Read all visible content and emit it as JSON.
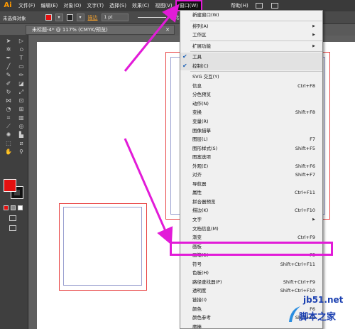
{
  "app": {
    "logo": "Ai"
  },
  "menubar": {
    "items": [
      {
        "label": "文件(F)"
      },
      {
        "label": "编辑(E)"
      },
      {
        "label": "对象(O)"
      },
      {
        "label": "文字(T)"
      },
      {
        "label": "选择(S)"
      },
      {
        "label": "效果(C)"
      },
      {
        "label": "视图(V)"
      },
      {
        "label": "窗口(W)",
        "active": true
      },
      {
        "label": "帮助(H)"
      }
    ]
  },
  "controlbar": {
    "selection": "未选择对象",
    "stroke_label": "描边",
    "stroke_weight": "1 pt",
    "stroke_style": "等比"
  },
  "document_tab": {
    "title": "未标题-4* @ 117% (CMYK/预览)"
  },
  "window_menu": {
    "items": [
      {
        "label": "新建窗口(W)"
      },
      {
        "sep": true
      },
      {
        "label": "排列(A)",
        "submenu": true
      },
      {
        "label": "工作区",
        "submenu": true
      },
      {
        "sep": true
      },
      {
        "label": "扩展功能",
        "submenu": true
      },
      {
        "sep": true
      },
      {
        "label": "工具",
        "checked": true
      },
      {
        "label": "控制(C)",
        "checked": true
      },
      {
        "sep": true
      },
      {
        "label": "SVG 交互(Y)"
      },
      {
        "label": "信息",
        "shortcut": "Ctrl+F8"
      },
      {
        "label": "分色预览"
      },
      {
        "label": "动作(N)"
      },
      {
        "label": "变换",
        "shortcut": "Shift+F8"
      },
      {
        "label": "变量(R)"
      },
      {
        "label": "图像描摹"
      },
      {
        "label": "图层(L)",
        "shortcut": "F7"
      },
      {
        "label": "图形样式(S)",
        "shortcut": "Shift+F5"
      },
      {
        "label": "图案选项"
      },
      {
        "label": "外观(E)",
        "shortcut": "Shift+F6"
      },
      {
        "label": "对齐",
        "shortcut": "Shift+F7"
      },
      {
        "label": "导航器"
      },
      {
        "label": "属性",
        "shortcut": "Ctrl+F11"
      },
      {
        "label": "拼合器预览"
      },
      {
        "label": "描边(K)",
        "shortcut": "Ctrl+F10"
      },
      {
        "label": "文字",
        "submenu": true
      },
      {
        "label": "文档信息(M)"
      },
      {
        "label": "渐变",
        "shortcut": "Ctrl+F9"
      },
      {
        "label": "画板",
        "highlight": true
      },
      {
        "label": "画笔(B)",
        "shortcut": "F5"
      },
      {
        "label": "符号",
        "shortcut": "Shift+Ctrl+F11"
      },
      {
        "label": "色板(H)"
      },
      {
        "label": "路径查找器(P)",
        "shortcut": "Shift+Ctrl+F9"
      },
      {
        "label": "透明度",
        "shortcut": "Shift+Ctrl+F10"
      },
      {
        "label": "链接(I)"
      },
      {
        "label": "颜色",
        "shortcut": "F6"
      },
      {
        "label": "颜色参考",
        "shortcut": "Shift+F3"
      },
      {
        "label": "魔棒"
      }
    ]
  },
  "watermark": {
    "url": "jb51.net",
    "site": "脚本之家"
  },
  "colors": {
    "accent": "#e21bd8",
    "fill": "#e41010",
    "artboard_border": "#e84040"
  }
}
